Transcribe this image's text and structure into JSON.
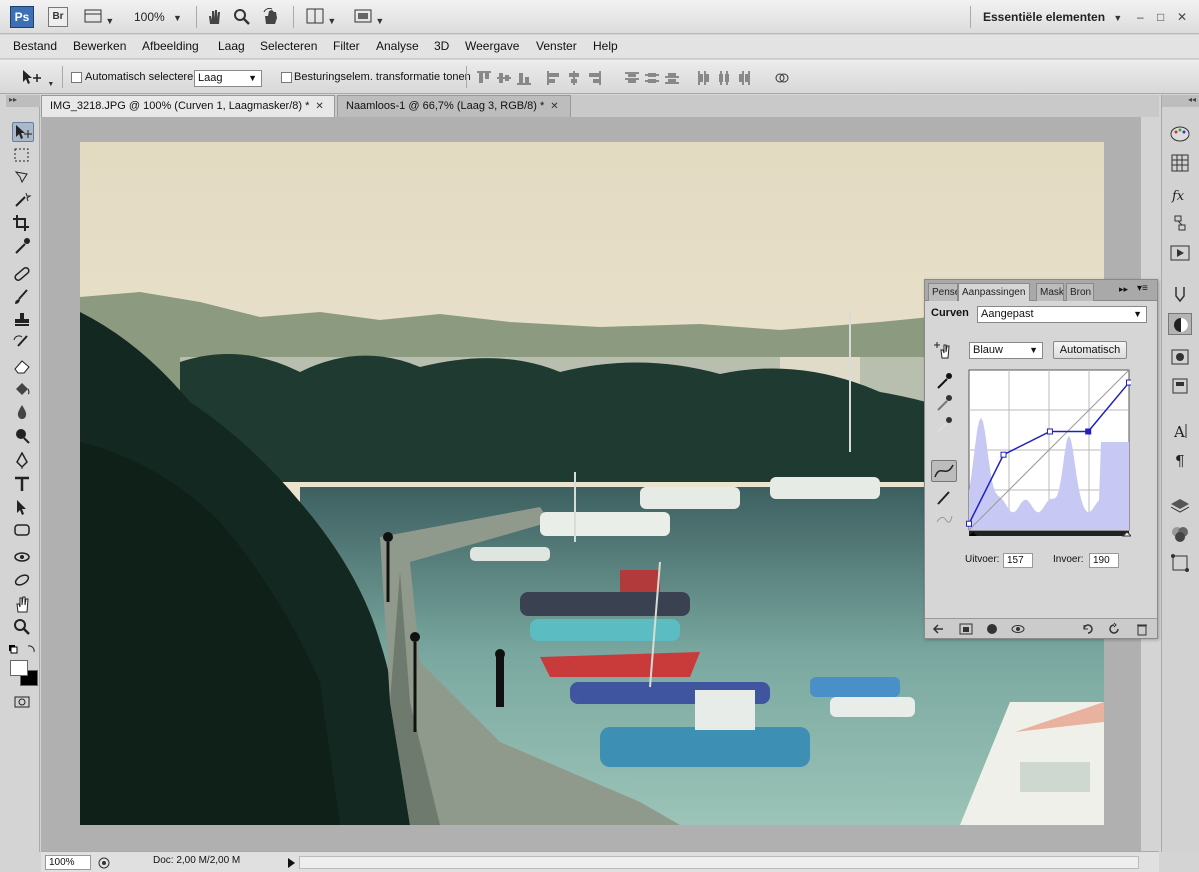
{
  "app_bar": {
    "ps_label": "Ps",
    "br_label": "Br",
    "zoom": "100%",
    "workspace": "Essentiële elementen"
  },
  "menu": [
    "Bestand",
    "Bewerken",
    "Afbeelding",
    "Laag",
    "Selecteren",
    "Filter",
    "Analyse",
    "3D",
    "Weergave",
    "Venster",
    "Help"
  ],
  "options": {
    "auto_select_label": "Automatisch selecteren:",
    "auto_select_value": "Laag",
    "transform_label": "Besturingselem. transformatie tonen"
  },
  "tabs": [
    {
      "label": "IMG_3218.JPG @ 100% (Curven 1, Laagmasker/8) *",
      "active": true
    },
    {
      "label": "Naamloos-1 @ 66,7% (Laag 3, RGB/8) *",
      "active": false
    }
  ],
  "panel": {
    "tabs": [
      "Pense",
      "Aanpassingen",
      "Maske",
      "Bron"
    ],
    "title": "Curven",
    "preset": "Aangepast",
    "channel": "Blauw",
    "auto_button": "Automatisch",
    "output_label": "Uitvoer:",
    "output_value": "157",
    "input_label": "Invoer:",
    "input_value": "190",
    "curve_points": [
      [
        0,
        10
      ],
      [
        55,
        120
      ],
      [
        129,
        157
      ],
      [
        190,
        157
      ],
      [
        255,
        235
      ]
    ]
  },
  "status": {
    "zoom": "100%",
    "doc": "Doc: 2,00 M/2,00 M"
  },
  "colors": {
    "accent": "#3c6fb4",
    "curve": "#2020c0",
    "histogram": "#c8c8f4"
  }
}
